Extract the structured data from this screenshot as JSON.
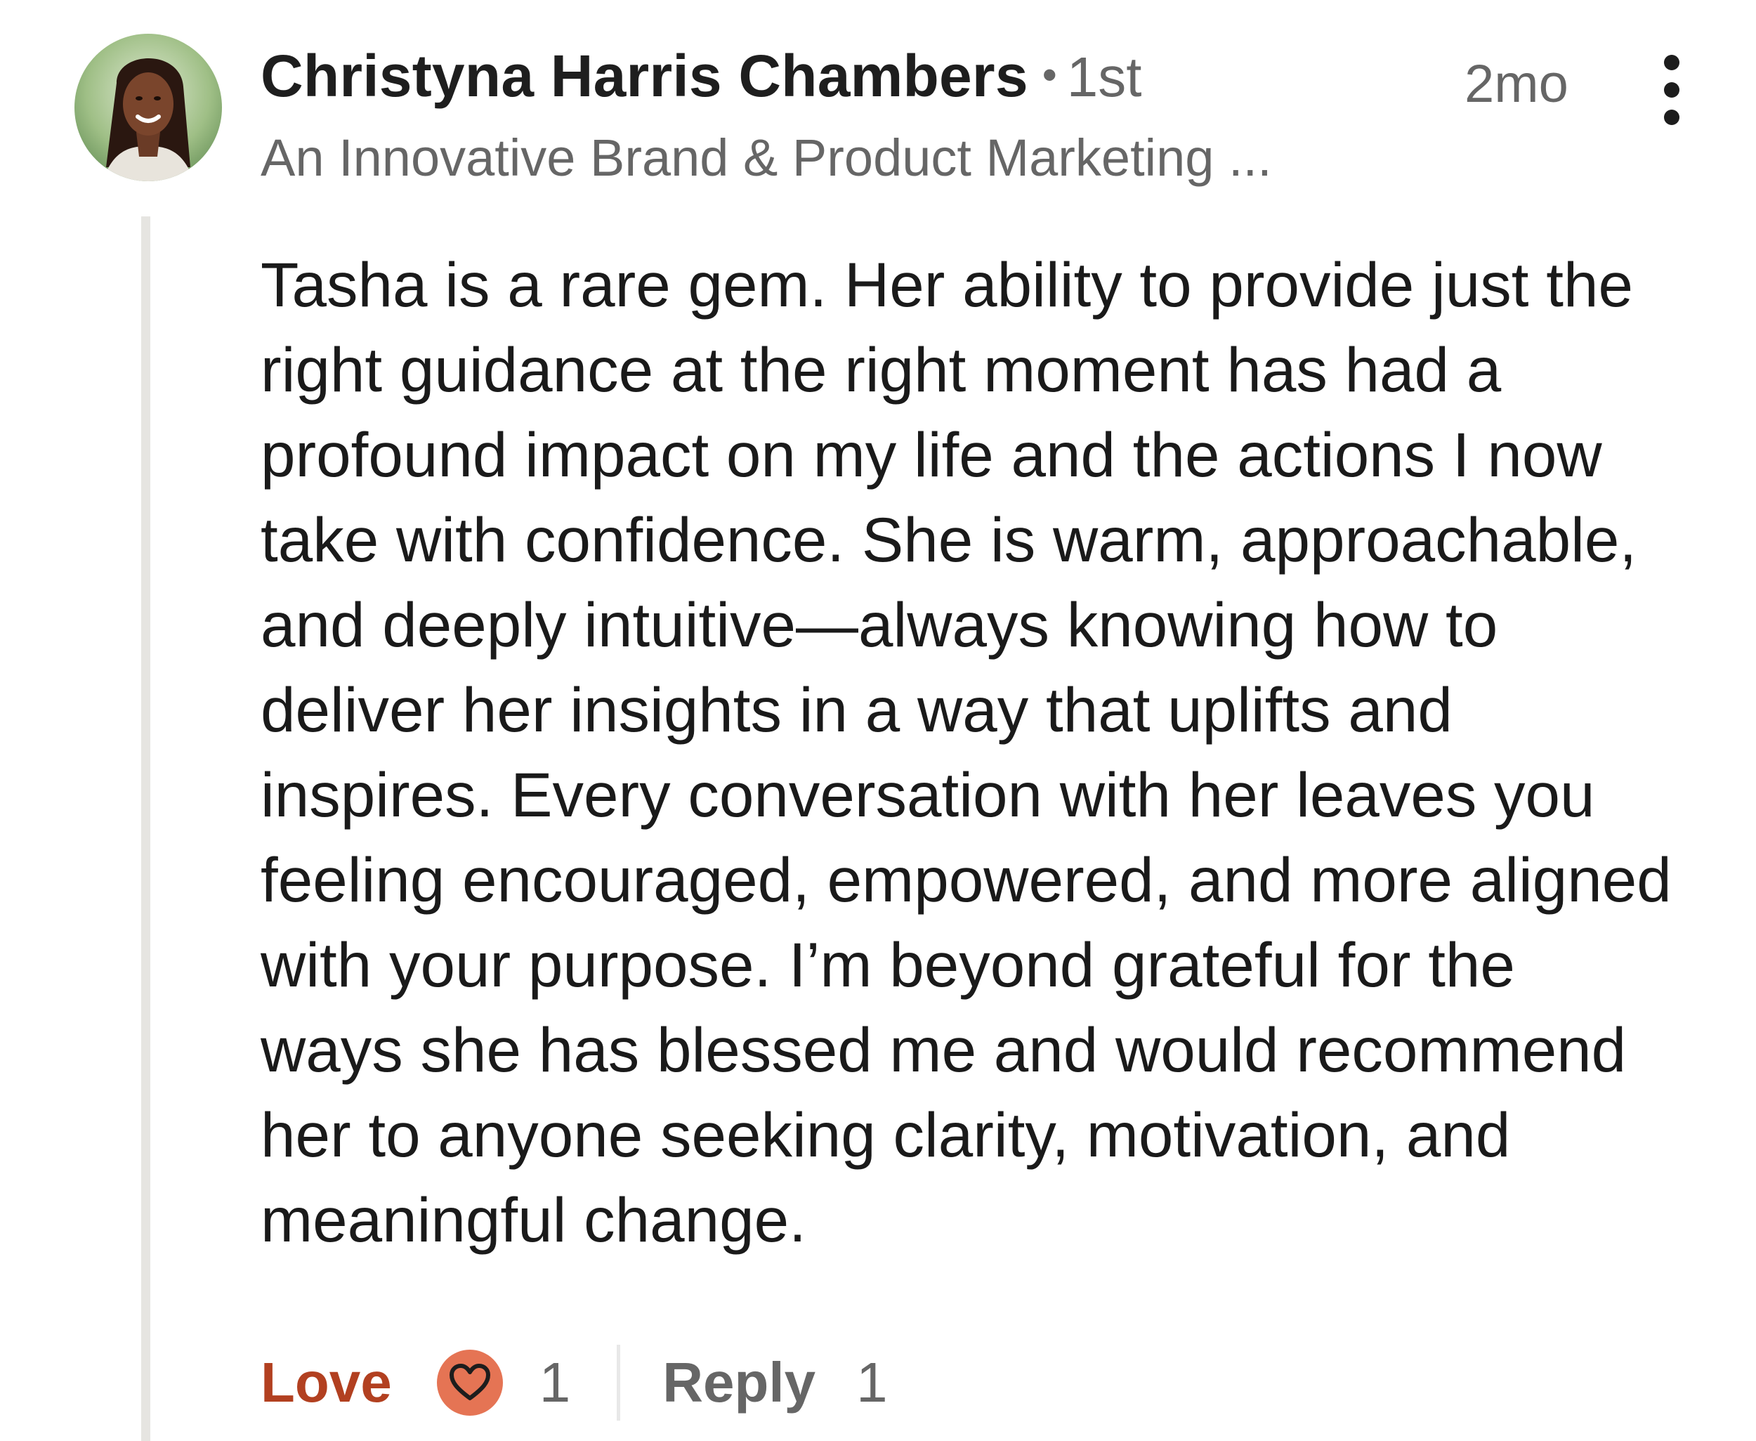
{
  "comment": {
    "author": {
      "name": "Christyna Harris Chambers",
      "separator": "•",
      "degree": "1st",
      "headline": "An Innovative Brand & Product Marketing ..."
    },
    "timestamp": "2mo",
    "body_lines": [
      "Tasha is a rare gem. Her ability to provide just the",
      "right guidance at the right moment has had a",
      "profound impact on my life and the actions I now",
      "take with confidence. She is warm, approachable,",
      "and deeply intuitive—always knowing how to",
      "deliver her insights in a way that uplifts and",
      "inspires. Every conversation with her leaves you",
      "feeling encouraged, empowered, and more aligned",
      "with your purpose. I’m beyond grateful for the",
      "ways she has blessed me and would recommend",
      "her to anyone seeking clarity, motivation, and",
      "meaningful change."
    ],
    "actions": {
      "reaction_label": "Love",
      "reaction_icon": "heart-icon",
      "reaction_count": "1",
      "reply_label": "Reply",
      "reply_count": "1"
    },
    "colors": {
      "reaction_text": "#b24020",
      "reaction_icon_bg": "#e57454",
      "secondary_text": "#666666",
      "thread_line": "#e6e5e1"
    }
  }
}
